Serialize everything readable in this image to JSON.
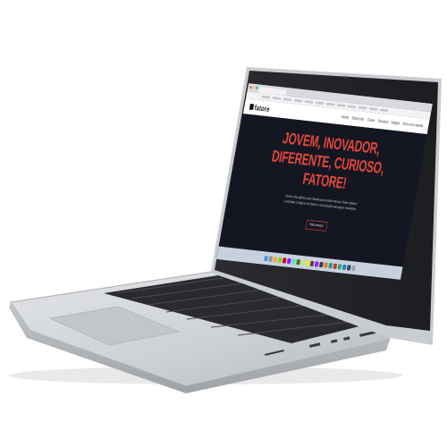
{
  "site": {
    "brand": "fatore",
    "nav": [
      "Home",
      "Sobre nós",
      "Cases",
      "Serviços",
      "Artigos",
      "Entre em contato"
    ]
  },
  "hero": {
    "title_line1": "JOVEM, INOVADOR,",
    "title_line2": "DIFERENTE, CURIOSO,",
    "title_line3": "FATORE!",
    "body": "Somos uma agência que trabalha para evoluir marcas. Nosso objetivo é entender o negócio do cliente e criar soluções para gerar resultados.",
    "button_label": "Fale conosco"
  },
  "colors": {
    "accent": "#e4483a",
    "hero_background": "#141622",
    "laptop_silver": "#d6d8db",
    "keyboard": "#2a2b2e"
  },
  "dock_colors": [
    "#4a90e2",
    "#8e8e93",
    "#f5a623",
    "#7ed321",
    "#d0021b",
    "#9013fe",
    "#50e3c2",
    "#417505",
    "#b8e986",
    "#f8e71c",
    "#4a4a4a",
    "#bd10e0",
    "#2c3e50",
    "#e67e22",
    "#16a085",
    "#c0392b",
    "#27ae60",
    "#2980b9",
    "#34495e",
    "#95a5a6"
  ]
}
